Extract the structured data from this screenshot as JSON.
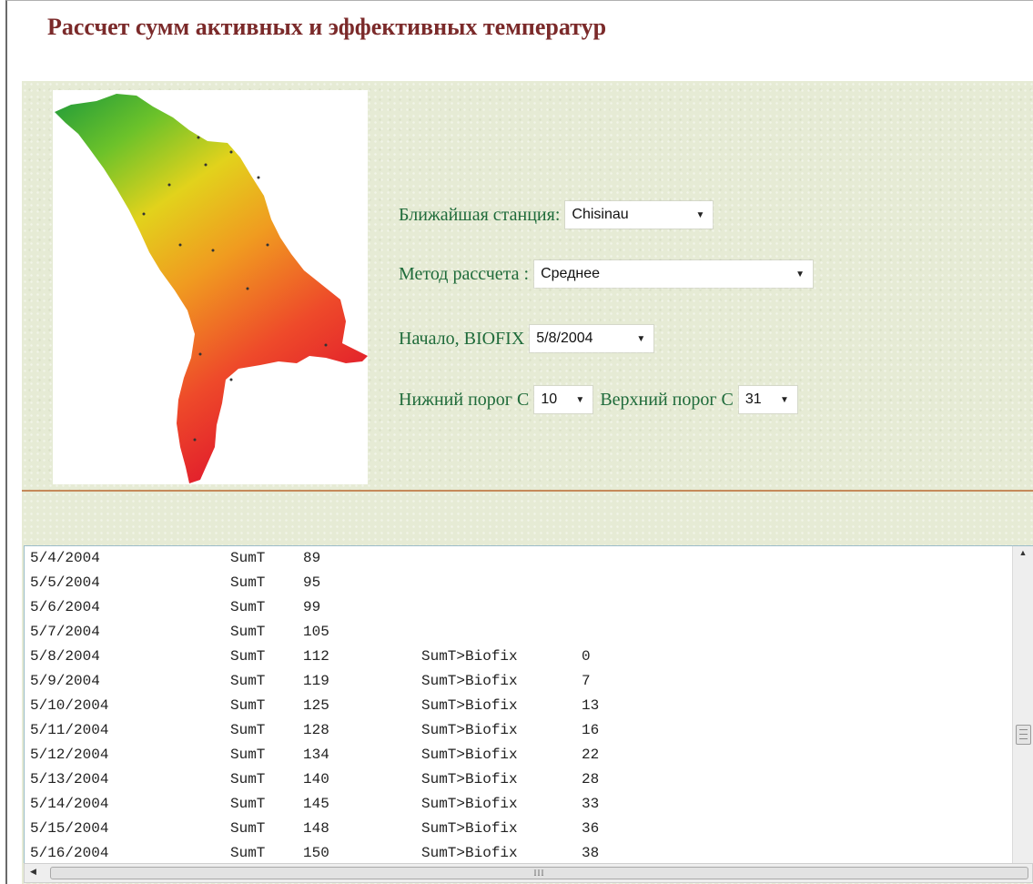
{
  "page": {
    "title": "Рассчет сумм активных и эффективных температур"
  },
  "form": {
    "station_label": "Ближайшая станция:",
    "station_value": "Chisinau",
    "method_label": "Метод рассчета :",
    "method_value": "Среднее",
    "biofix_label": "Начало, BIOFIX",
    "biofix_value": "5/8/2004",
    "lower_label": "Нижний порог С",
    "lower_value": "10",
    "upper_label": "Верхний порог С",
    "upper_value": "31"
  },
  "output": {
    "rows": [
      {
        "date": "5/4/2004",
        "sum_label": "SumT",
        "sum": "89",
        "bio_label": "",
        "bio": ""
      },
      {
        "date": "5/5/2004",
        "sum_label": "SumT",
        "sum": "95",
        "bio_label": "",
        "bio": ""
      },
      {
        "date": "5/6/2004",
        "sum_label": "SumT",
        "sum": "99",
        "bio_label": "",
        "bio": ""
      },
      {
        "date": "5/7/2004",
        "sum_label": "SumT",
        "sum": "105",
        "bio_label": "",
        "bio": ""
      },
      {
        "date": "5/8/2004",
        "sum_label": "SumT",
        "sum": "112",
        "bio_label": "SumT>Biofix",
        "bio": "0"
      },
      {
        "date": "5/9/2004",
        "sum_label": "SumT",
        "sum": "119",
        "bio_label": "SumT>Biofix",
        "bio": "7"
      },
      {
        "date": "5/10/2004",
        "sum_label": "SumT",
        "sum": "125",
        "bio_label": "SumT>Biofix",
        "bio": "13"
      },
      {
        "date": "5/11/2004",
        "sum_label": "SumT",
        "sum": "128",
        "bio_label": "SumT>Biofix",
        "bio": "16"
      },
      {
        "date": "5/12/2004",
        "sum_label": "SumT",
        "sum": "134",
        "bio_label": "SumT>Biofix",
        "bio": "22"
      },
      {
        "date": "5/13/2004",
        "sum_label": "SumT",
        "sum": "140",
        "bio_label": "SumT>Biofix",
        "bio": "28"
      },
      {
        "date": "5/14/2004",
        "sum_label": "SumT",
        "sum": "145",
        "bio_label": "SumT>Biofix",
        "bio": "33"
      },
      {
        "date": "5/15/2004",
        "sum_label": "SumT",
        "sum": "148",
        "bio_label": "SumT>Biofix",
        "bio": "36"
      },
      {
        "date": "5/16/2004",
        "sum_label": "SumT",
        "sum": "150",
        "bio_label": "SumT>Biofix",
        "bio": "38"
      }
    ]
  },
  "icons": {
    "dropdown": "chevron-down-icon",
    "scroll_up": "scroll-up-icon",
    "scroll_left": "scroll-left-icon",
    "grip": "grip-icon"
  },
  "colors": {
    "title": "#7b2a2a",
    "label": "#1f6b3a",
    "panel_bg": "#e6ebd5",
    "divider": "#c58a5a",
    "map_high": "#e8242c",
    "map_mid": "#f0c21a",
    "map_low": "#1f9a3a"
  }
}
